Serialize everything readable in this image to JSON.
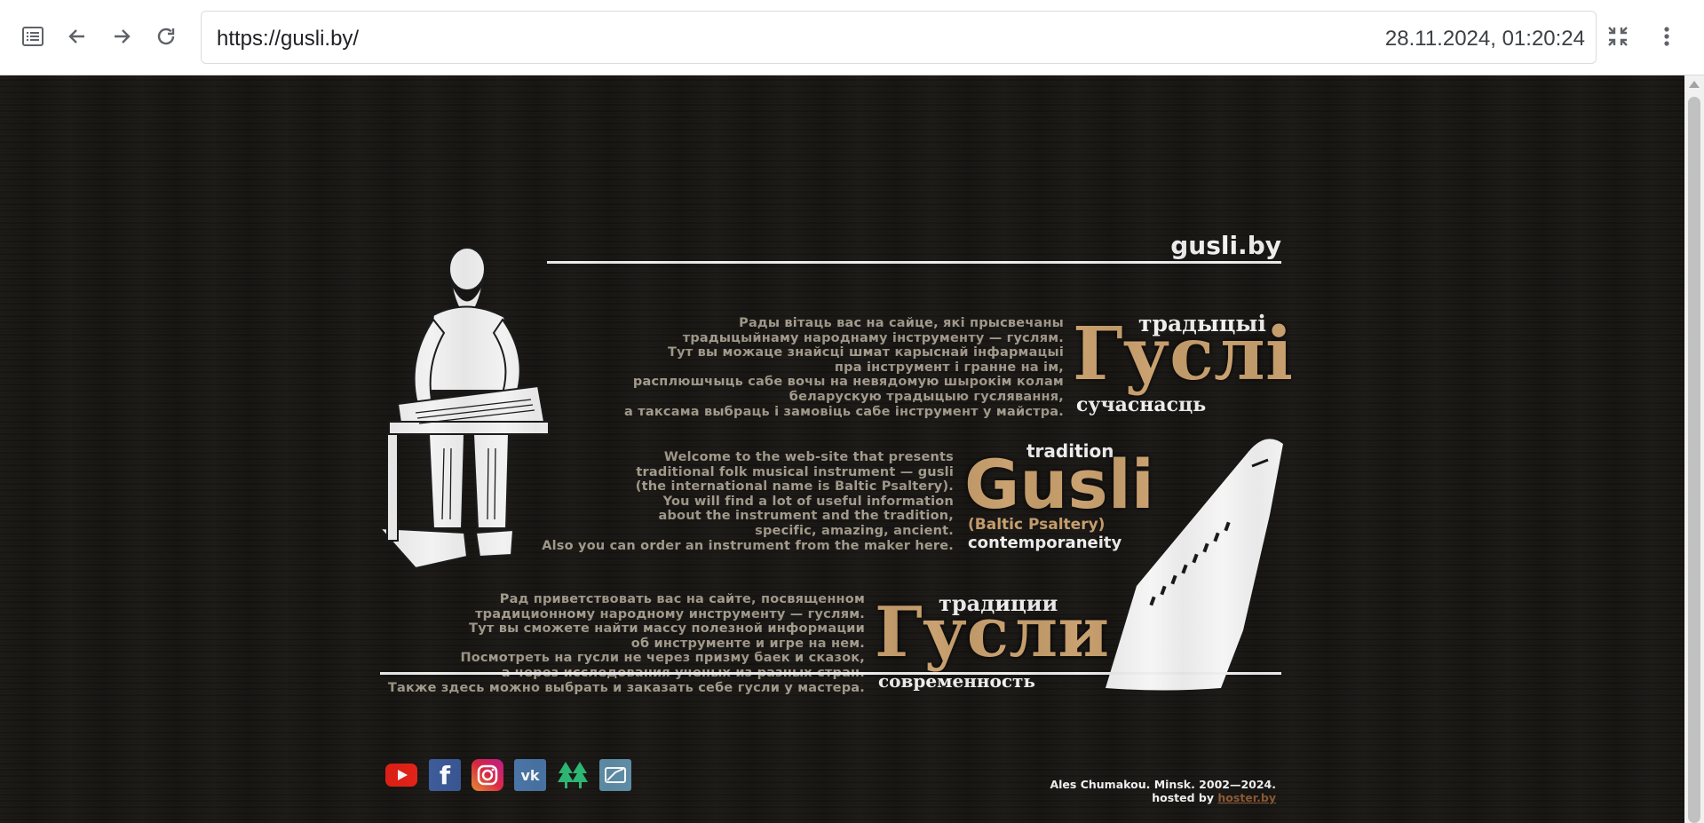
{
  "browser": {
    "url": "https://gusli.by/",
    "datetime": "28.11.2024, 01:20:24",
    "icons": {
      "menu": "list-icon",
      "back": "arrow-left-icon",
      "forward": "arrow-right-icon",
      "reload": "reload-icon",
      "exit_fullscreen": "compress-icon",
      "more": "kebab-menu-icon"
    }
  },
  "site": {
    "title": "gusli.by",
    "background": "#1a1815",
    "text_color": "#a39b8c",
    "accent_color": "#c9a06e"
  },
  "belarusian": {
    "lines": [
      "Рады вітаць вас на сайце, які прысвечаны",
      "традыцыйнаму народнаму інструменту — гуслям.",
      "Тут вы можаце знайсці шмат карыснай інфармацыі",
      "пра інструмент і гранне на ім,",
      "расплюшчыць сабе вочы на невядомую шырокім колам",
      "беларускую традыцыю гуслявання,",
      "а таксама выбраць і замовіць сабе інструмент у майстра."
    ],
    "logo": {
      "top": "традыцыі",
      "main": "Гуслі",
      "bottom": "сучаснасць"
    }
  },
  "english": {
    "lines": [
      "Welcome to the web-site that presents",
      "traditional folk musical instrument — gusli",
      "(the international name is Baltic Psaltery).",
      "You will find a lot of useful information",
      "about the instrument and the tradition,",
      "specific, amazing, ancient.",
      "Also you can order an instrument from the maker here."
    ],
    "logo": {
      "top": "tradition",
      "main": "Gusli",
      "sub": "(Baltic Psaltery)",
      "bottom": "contemporaneity"
    }
  },
  "russian": {
    "lines": [
      "Рад приветствовать вас на сайте, посвященном",
      "традиционному народному инструменту — гуслям.",
      "Тут вы сможете найти массу полезной информации",
      "об инструменте и игре на нем.",
      "Посмотреть на гусли не через призму баек и сказок,",
      "а через исследования ученых из разных стран.",
      "Также здесь можно выбрать и заказать себе гусли у мастера."
    ],
    "logo": {
      "top": "традиции",
      "main": "Гусли",
      "bottom": "современность"
    }
  },
  "social": [
    {
      "name": "youtube-icon",
      "color": "#e62117",
      "glyph": "▶"
    },
    {
      "name": "facebook-icon",
      "color": "#3b5998",
      "glyph": "f"
    },
    {
      "name": "instagram-icon",
      "color": "#d6249f",
      "glyph": "◎"
    },
    {
      "name": "vk-icon",
      "color": "#4a76a8",
      "glyph": "vk"
    },
    {
      "name": "trees-icon",
      "color": "#2bb673",
      "glyph": "♣"
    },
    {
      "name": "zen-icon",
      "color": "#5f8fa8",
      "glyph": "✉"
    }
  ],
  "footer": {
    "line1": "Ales Chumakou. Minsk. 2002—2024.",
    "hosted_by": "hosted by",
    "host_link": "hoster.by"
  }
}
